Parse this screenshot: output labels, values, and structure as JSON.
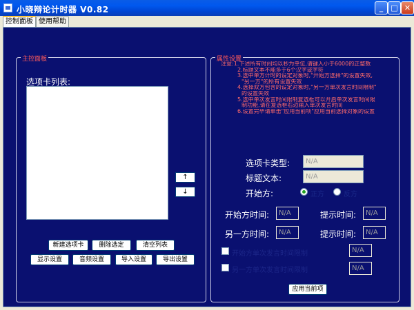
{
  "window": {
    "title": "小晓辩论计时器 V0.82"
  },
  "tabs": [
    "控制面板",
    "使用帮助"
  ],
  "main_panel": {
    "legend": "主控面板",
    "list_label": "选项卡列表:",
    "move_up": "↑",
    "move_down": "↓",
    "buttons_row1": [
      "新建选项卡",
      "删除选定",
      "清空列表"
    ],
    "buttons_row2": [
      "显示设置",
      "音频设置",
      "导入设置",
      "导出设置"
    ]
  },
  "prop_panel": {
    "legend": "属性设置",
    "notes": [
      "注意:1.下述所有时间均以秒为单位,请键入小于6000的正整数",
      "2.标题文本不能多于6个汉字或字符",
      "3.选中单方计时的设定对象时,\"开始方选择\"的设置失效,",
      "\"另一方\"的所有设置失效",
      "4.选择双方包含的设定对象时,\"另一方单次发言时间限制\"",
      "的设置失效",
      "5.选中单次发言时间限制复选框可以开启单次发言时间限",
      "制功能,请在复选框右边输入单次发言时间",
      "6.设置完毕请单击\"应用当前项\"应用当前选择对象的设置"
    ],
    "tab_type_label": "选项卡类型:",
    "tab_type_value": "N/A",
    "title_text_label": "标题文本:",
    "title_text_value": "N/A",
    "start_side_label": "开始方:",
    "radio1_label": "正方",
    "radio2_label": "反方",
    "start_time_label": "开始方时间:",
    "start_time_value": "N/A",
    "hint_time_label1": "提示时间:",
    "hint_time_value1": "N/A",
    "other_time_label": "另一方时间:",
    "other_time_value": "N/A",
    "hint_time_label2": "提示时间:",
    "hint_time_value2": "N/A",
    "check1_label": "开始方单次发言时间限制",
    "check1_value": "N/A",
    "check2_label": "另一方单次发言时间限制",
    "check2_value": "N/A",
    "apply_label": "应用当前项"
  }
}
